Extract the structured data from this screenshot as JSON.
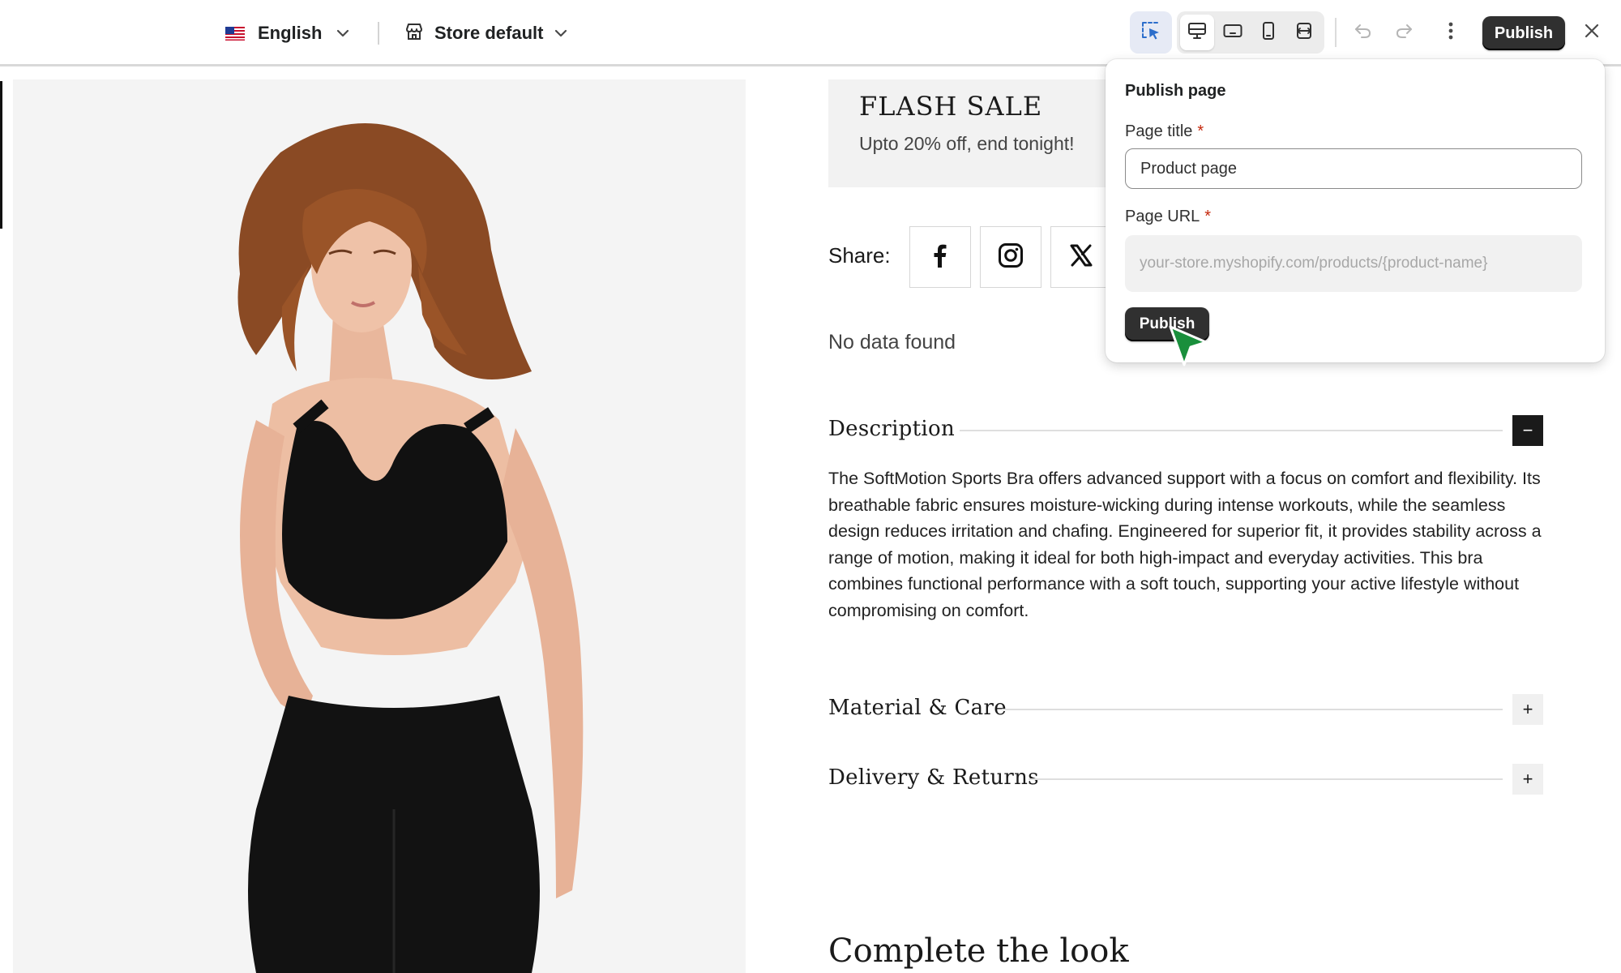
{
  "toolbar": {
    "language_label": "English",
    "store_label": "Store default",
    "publish_label": "Publish",
    "icons": {
      "flag": "us-flag-icon",
      "store": "store-icon",
      "select": "select-cursor-icon",
      "desktop": "desktop-icon",
      "tablet": "tablet-landscape-icon",
      "mobile": "mobile-icon",
      "fullwidth": "full-width-icon",
      "undo": "undo-icon",
      "redo": "redo-icon",
      "more": "more-vertical-icon",
      "close": "close-icon"
    }
  },
  "page": {
    "flash_sale": {
      "title": "FLASH SALE",
      "subtitle": "Upto 20% off, end tonight!"
    },
    "share": {
      "label": "Share:",
      "networks": [
        "facebook-icon",
        "instagram-icon",
        "x-twitter-icon"
      ]
    },
    "no_data": "No data found",
    "accordions": [
      {
        "title": "Description",
        "toggle": "−",
        "open": true,
        "body": "The SoftMotion Sports Bra offers advanced support with a focus on comfort and flexibility. Its breathable fabric ensures moisture-wicking during intense workouts, while the seamless design reduces irritation and chafing. Engineered for superior fit, it provides stability across a range of motion, making it ideal for both high-impact and everyday activities. This bra combines functional performance with a soft touch, supporting your active lifestyle without compromising on comfort."
      },
      {
        "title": "Material & Care",
        "toggle": "+",
        "open": false
      },
      {
        "title": "Delivery & Returns",
        "toggle": "+",
        "open": false
      }
    ],
    "complete_look": "Complete the look"
  },
  "publish_popover": {
    "title": "Publish page",
    "page_title_label": "Page title",
    "page_title_value": "Product page",
    "page_url_label": "Page URL",
    "page_url_placeholder": "your-store.myshopify.com/products/{product-name}",
    "required_mark": "*",
    "publish_button": "Publish"
  },
  "colors": {
    "primary_button": "#303030",
    "required": "#c5280c",
    "accent_select": "#2c6ecb",
    "cursor": "#1a8f3c"
  }
}
